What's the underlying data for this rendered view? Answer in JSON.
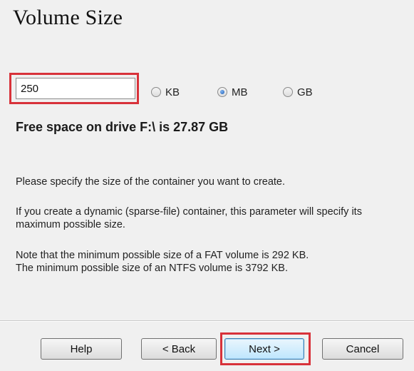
{
  "wizard": {
    "title": "Volume Size"
  },
  "size": {
    "value": "250",
    "units": [
      {
        "label": "KB",
        "checked": false
      },
      {
        "label": "MB",
        "checked": true
      },
      {
        "label": "GB",
        "checked": false
      }
    ]
  },
  "free_space": "Free space on drive F:\\ is 27.87 GB",
  "info": {
    "line1": "Please specify the size of the container you want to create.",
    "line2": "If you create a dynamic (sparse-file) container, this parameter will specify its maximum possible size.",
    "line3a": "Note that the minimum possible size of a FAT volume is 292 KB.",
    "line3b": "The minimum possible size of an NTFS volume is 3792 KB."
  },
  "buttons": {
    "help": "Help",
    "back": "< Back",
    "next": "Next >",
    "cancel": "Cancel"
  },
  "colors": {
    "highlight": "#d8323a",
    "background": "#f0f0f0"
  }
}
